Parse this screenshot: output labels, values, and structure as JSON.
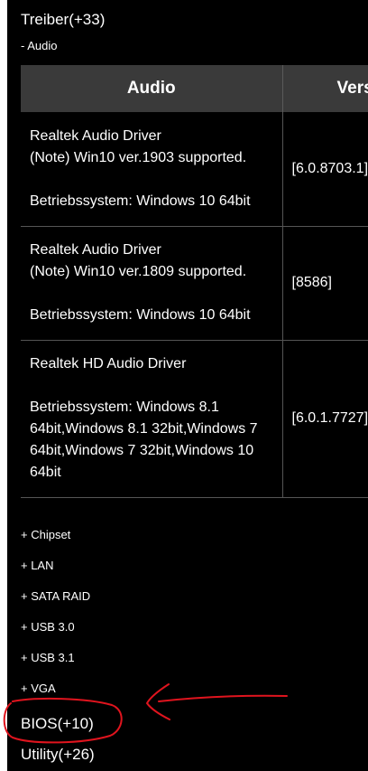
{
  "header": {
    "treiber_link": "Treiber(+33)",
    "current_category": "- Audio"
  },
  "table": {
    "columns": [
      "Audio",
      "Vers"
    ],
    "rows": [
      {
        "name": "Realtek Audio Driver",
        "note": "(Note) Win10 ver.1903 supported.",
        "os": "Betriebssystem: Windows 10 64bit",
        "version": "[6.0.8703.1]"
      },
      {
        "name": "Realtek Audio Driver",
        "note": "(Note) Win10 ver.1809 supported.",
        "os": "Betriebssystem: Windows 10 64bit",
        "version": "[8586]"
      },
      {
        "name": "Realtek HD Audio Driver",
        "note": "",
        "os": "Betriebssystem: Windows 8.1 64bit,Windows 8.1 32bit,Windows 7 64bit,Windows 7 32bit,Windows 10 64bit",
        "version": "[6.0.1.7727]"
      }
    ]
  },
  "categories": [
    "+ Chipset",
    "+ LAN",
    "+ SATA RAID",
    "+ USB 3.0",
    "+ USB 3.1",
    "+ VGA"
  ],
  "footer": {
    "bios_link": "BIOS(+10)",
    "utility_link": "Utility(+26)"
  },
  "annotation": {
    "color": "#e0141e"
  }
}
